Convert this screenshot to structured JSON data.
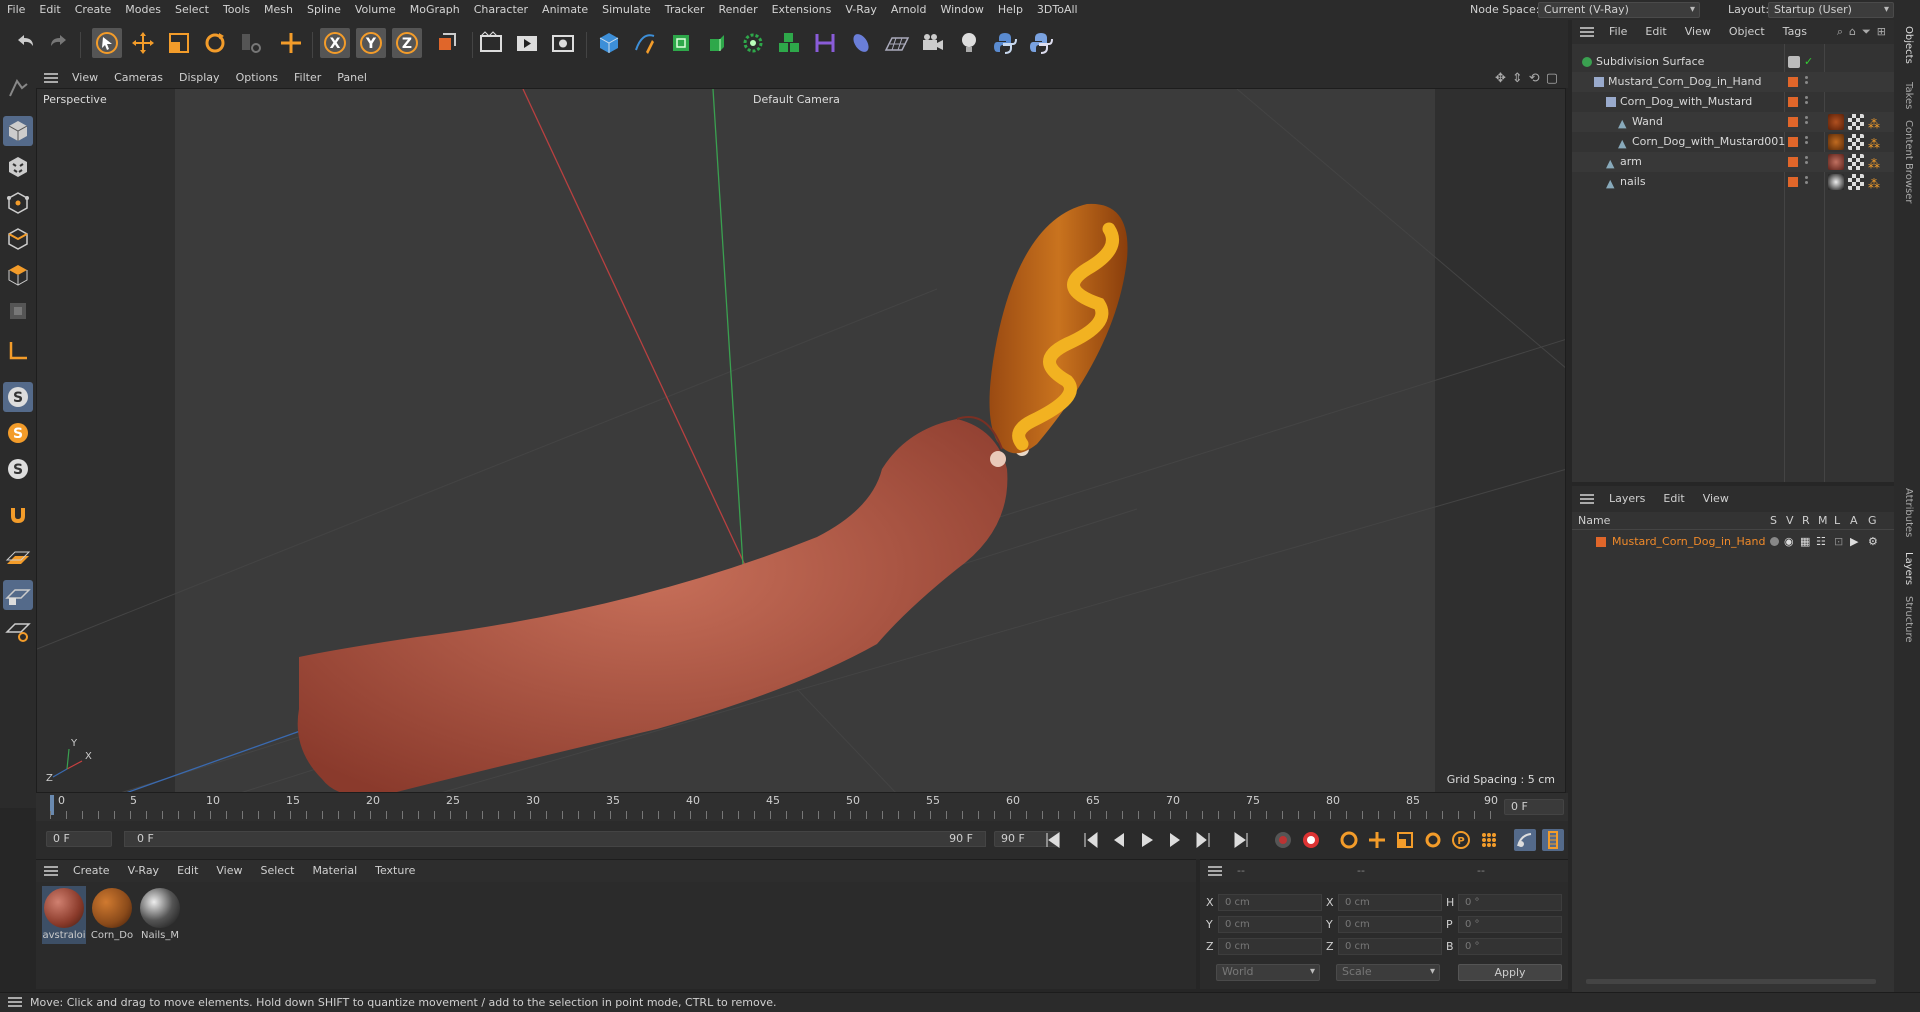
{
  "menubar": {
    "items": [
      "File",
      "Edit",
      "Create",
      "Modes",
      "Select",
      "Tools",
      "Mesh",
      "Spline",
      "Volume",
      "MoGraph",
      "Character",
      "Animate",
      "Simulate",
      "Tracker",
      "Render",
      "Extensions",
      "V-Ray",
      "Arnold",
      "Window",
      "Help",
      "3DToAll"
    ],
    "node_space_label": "Node Space:",
    "node_space_value": "Current (V-Ray)",
    "layout_label": "Layout:",
    "layout_value": "Startup (User)"
  },
  "toolbar": {
    "icons": [
      "undo-icon",
      "redo-icon",
      "select-arrow-icon",
      "move-icon",
      "scale-icon",
      "rotate-icon",
      "recent-tools-icon",
      "axis-move-icon",
      "x-axis-icon",
      "y-axis-icon",
      "z-axis-icon",
      "coordinate-system-icon",
      "render-region-icon",
      "render-view-icon",
      "render-settings-icon",
      "cube-primitive-icon",
      "pen-spline-icon",
      "subdivision-icon",
      "extrude-icon",
      "cloner-icon",
      "mograph-icon",
      "deformer-icon",
      "field-icon",
      "floor-icon",
      "camera-icon",
      "light-icon",
      "python-icon",
      "python2-icon"
    ]
  },
  "viewport": {
    "menus": [
      "View",
      "Cameras",
      "Display",
      "Options",
      "Filter",
      "Panel"
    ],
    "view_name": "Perspective",
    "camera_label": "Default Camera",
    "grid_spacing": "Grid Spacing : 5 cm"
  },
  "timeline": {
    "ticks": [
      "0",
      "5",
      "10",
      "15",
      "20",
      "25",
      "30",
      "35",
      "40",
      "45",
      "50",
      "55",
      "60",
      "65",
      "70",
      "75",
      "80",
      "85",
      "90"
    ],
    "frame_end_field": "0 F",
    "current_frame": "0 F",
    "range_start": "0 F",
    "range_end": "90 F",
    "end_frame": "90 F"
  },
  "materials": {
    "menus": [
      "Create",
      "V-Ray",
      "Edit",
      "View",
      "Select",
      "Material",
      "Texture"
    ],
    "items": [
      {
        "name": "avstraloi",
        "color": "#8a3a2a"
      },
      {
        "name": "Corn_Do",
        "color": "#8a4a1a"
      },
      {
        "name": "Nails_M",
        "color": "#222222"
      }
    ]
  },
  "coordinates": {
    "headers": [
      "--",
      "--",
      "--"
    ],
    "rows": [
      {
        "a": "X",
        "av": "0 cm",
        "b": "X",
        "bv": "0 cm",
        "c": "H",
        "cv": "0 °"
      },
      {
        "a": "Y",
        "av": "0 cm",
        "b": "Y",
        "bv": "0 cm",
        "c": "P",
        "cv": "0 °"
      },
      {
        "a": "Z",
        "av": "0 cm",
        "b": "Z",
        "bv": "0 cm",
        "c": "B",
        "cv": "0 °"
      }
    ],
    "world": "World",
    "scale": "Scale",
    "apply": "Apply"
  },
  "objects": {
    "menus": [
      "File",
      "Edit",
      "View",
      "Object",
      "Tags"
    ],
    "tree": [
      {
        "name": "Subdivision Surface",
        "level": 0
      },
      {
        "name": "Mustard_Corn_Dog_in_Hand",
        "level": 1
      },
      {
        "name": "Corn_Dog_with_Mustard",
        "level": 2
      },
      {
        "name": "Wand",
        "level": 3
      },
      {
        "name": "Corn_Dog_with_Mustard001",
        "level": 3
      },
      {
        "name": "arm",
        "level": 2
      },
      {
        "name": "nails",
        "level": 2
      }
    ]
  },
  "layers": {
    "menus": [
      "Layers",
      "Edit",
      "View"
    ],
    "col_name": "Name",
    "cols": [
      "S",
      "V",
      "R",
      "M",
      "L",
      "A",
      "G"
    ],
    "rows": [
      {
        "name": "Mustard_Corn_Dog_in_Hand",
        "color": "#e0662a"
      }
    ]
  },
  "right_tabs": [
    "Objects",
    "Takes",
    "Content Browser",
    "Attributes",
    "Layers",
    "Structure"
  ],
  "status": "Move: Click and drag to move elements. Hold down SHIFT to quantize movement / add to the selection in point mode, CTRL to remove."
}
